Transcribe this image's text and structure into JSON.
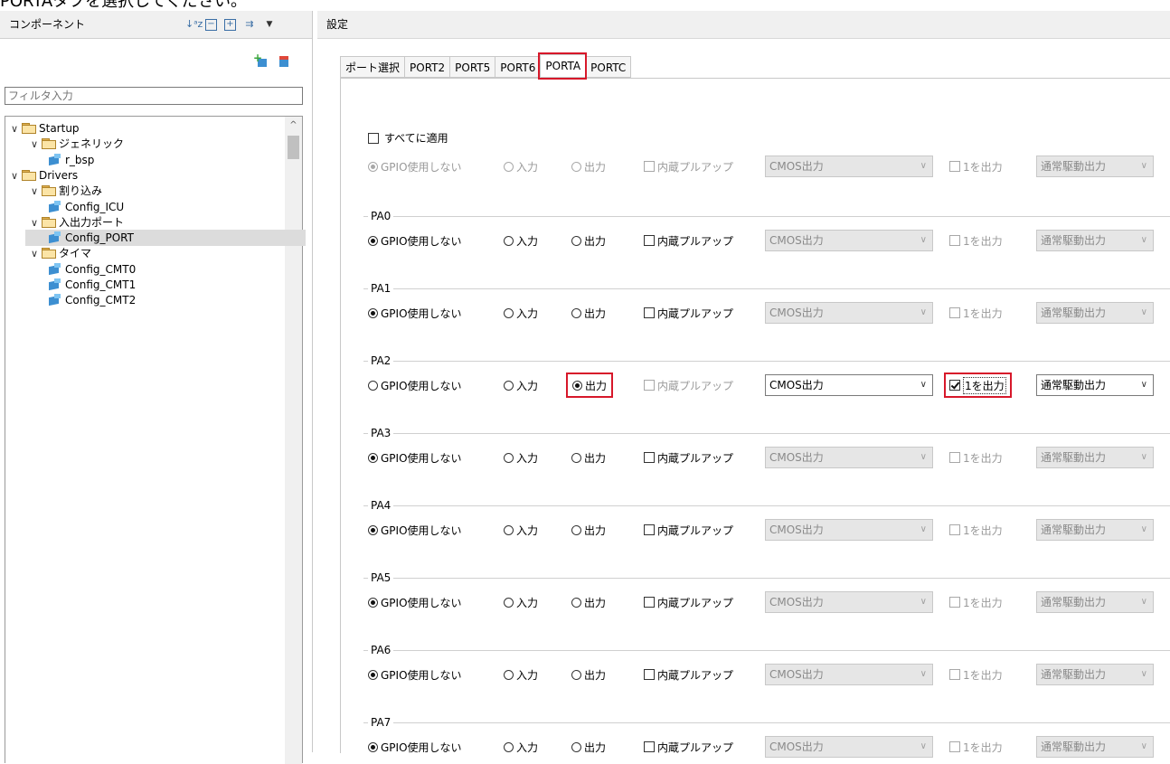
{
  "caption": "PORTAタブを選択してください。",
  "left_panel": {
    "title": "コンポーネント",
    "filter_placeholder": "フィルタ入力",
    "tree": [
      {
        "label": "Startup",
        "level": 0,
        "kind": "folder"
      },
      {
        "label": "ジェネリック",
        "level": 1,
        "kind": "folder"
      },
      {
        "label": "r_bsp",
        "level": 2,
        "kind": "component"
      },
      {
        "label": "Drivers",
        "level": 0,
        "kind": "folder"
      },
      {
        "label": "割り込み",
        "level": 1,
        "kind": "folder"
      },
      {
        "label": "Config_ICU",
        "level": 2,
        "kind": "component"
      },
      {
        "label": "入出力ポート",
        "level": 1,
        "kind": "folder"
      },
      {
        "label": "Config_PORT",
        "level": 2,
        "kind": "component",
        "selected": true
      },
      {
        "label": "タイマ",
        "level": 1,
        "kind": "folder"
      },
      {
        "label": "Config_CMT0",
        "level": 2,
        "kind": "component"
      },
      {
        "label": "Config_CMT1",
        "level": 2,
        "kind": "component"
      },
      {
        "label": "Config_CMT2",
        "level": 2,
        "kind": "component"
      }
    ]
  },
  "right_panel": {
    "title": "設定",
    "tabs": [
      "ポート選択",
      "PORT2",
      "PORT5",
      "PORT6",
      "PORTA",
      "PORTC"
    ],
    "active_tab": "PORTA",
    "apply_all_label": "すべてに適用",
    "options": {
      "gpio_unused": "GPIO使用しない",
      "input": "入力",
      "output": "出力",
      "pullup": "内蔵プルアップ",
      "cmos": "CMOS出力",
      "output_one": "1を出力",
      "drive": "通常駆動出力"
    },
    "pins": [
      {
        "name": "PA0",
        "mode": "gpio_unused"
      },
      {
        "name": "PA1",
        "mode": "gpio_unused"
      },
      {
        "name": "PA2",
        "mode": "output",
        "output_one": true
      },
      {
        "name": "PA3",
        "mode": "gpio_unused"
      },
      {
        "name": "PA4",
        "mode": "gpio_unused"
      },
      {
        "name": "PA5",
        "mode": "gpio_unused"
      },
      {
        "name": "PA6",
        "mode": "gpio_unused"
      },
      {
        "name": "PA7",
        "mode": "gpio_unused"
      }
    ]
  },
  "colors": {
    "highlight": "#d7182a",
    "selection": "#dcdcdc"
  }
}
